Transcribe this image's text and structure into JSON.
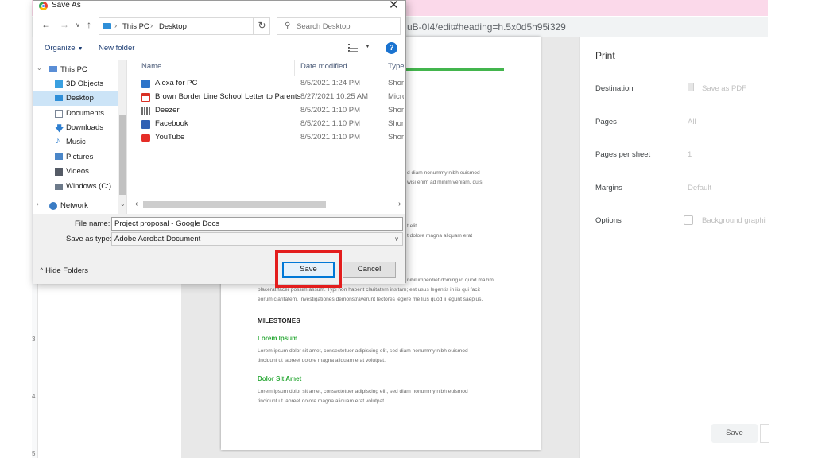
{
  "browser": {
    "url_fragment": "uB-0I4/edit#heading=h.5x0d5h95i329"
  },
  "ruler": {
    "marks": [
      "3",
      "4",
      "5"
    ]
  },
  "document_page": {
    "fragments": [
      "d diam nonummy nibh euismod",
      "wisi enim ad minim veniam, quis",
      "t elit",
      "t dolore magna aliquam erat",
      "nihil imperdiet doming id quod mazim"
    ],
    "para_lines": [
      "placerat facer possim assum. Typi non habent claritatem insitam; est usus legentis in iis qui facit",
      "eorum claritatem. Investigationes demonstraverunt lectores legere me lius quod ii legunt saepius."
    ],
    "milestones_heading": "MILESTONES",
    "sections": [
      {
        "title": "Lorem Ipsum",
        "lines": [
          "Lorem ipsum dolor sit amet, consectetuer adipiscing elit, sed diam nonummy nibh euismod",
          "tincidunt ut laoreet dolore magna aliquam erat volutpat."
        ]
      },
      {
        "title": "Dolor Sit Amet",
        "lines": [
          "Lorem ipsum dolor sit amet, consectetuer adipiscing elit, sed diam nonummy nibh euismod",
          "tincidunt ut laoreet dolore magna aliquam erat volutpat."
        ]
      }
    ]
  },
  "print_panel": {
    "title": "Print",
    "destination_label": "Destination",
    "destination_value": "Save as PDF",
    "pages_label": "Pages",
    "pages_value": "All",
    "pages_per_sheet_label": "Pages per sheet",
    "pages_per_sheet_value": "1",
    "margins_label": "Margins",
    "margins_value": "Default",
    "options_label": "Options",
    "options_value": "Background graphi",
    "save_label": "Save"
  },
  "dialog": {
    "title": "Save As",
    "close_glyph": "✕",
    "nav": {
      "back": "←",
      "forward": "→",
      "recent": "∨",
      "up": "↑",
      "refresh": "↻",
      "dropdown": "∨"
    },
    "breadcrumb": [
      "This PC",
      "Desktop"
    ],
    "search_placeholder": "Search Desktop",
    "search_glyph": "⚲",
    "toolbar": {
      "organize": "Organize",
      "new_folder": "New folder",
      "help": "?"
    },
    "nav_items": [
      {
        "label": "This PC",
        "icon": "computer-icon",
        "color": "#5a8ed6"
      },
      {
        "label": "3D Objects",
        "icon": "cube-icon",
        "color": "#3aa0e0"
      },
      {
        "label": "Desktop",
        "icon": "desktop-folder-icon",
        "color": "#2f8fd8"
      },
      {
        "label": "Documents",
        "icon": "documents-icon",
        "color": "#7a8696"
      },
      {
        "label": "Downloads",
        "icon": "download-icon",
        "color": "#2f7fd0"
      },
      {
        "label": "Music",
        "icon": "music-icon",
        "color": "#2f7fd0"
      },
      {
        "label": "Pictures",
        "icon": "pictures-icon",
        "color": "#4a86c8"
      },
      {
        "label": "Videos",
        "icon": "videos-icon",
        "color": "#555b66"
      },
      {
        "label": "Windows (C:)",
        "icon": "drive-icon",
        "color": "#6d7a8a"
      },
      {
        "label": "Network",
        "icon": "network-icon",
        "color": "#3a7cc4"
      }
    ],
    "columns": {
      "name": "Name",
      "date": "Date modified",
      "type": "Type"
    },
    "files": [
      {
        "name": "Alexa for PC",
        "date": "8/5/2021 1:24 PM",
        "type": "Short",
        "icon": "alexa-shortcut-icon",
        "color": "#2d74c9"
      },
      {
        "name": "Brown Border Line School Letter to Parents",
        "date": "8/27/2021 10:25 AM",
        "type": "Micro",
        "icon": "pdf-file-icon",
        "color": "#d93025"
      },
      {
        "name": "Deezer",
        "date": "8/5/2021 1:10 PM",
        "type": "Short",
        "icon": "deezer-shortcut-icon",
        "color": "#6d6d6d"
      },
      {
        "name": "Facebook",
        "date": "8/5/2021 1:10 PM",
        "type": "Short",
        "icon": "facebook-shortcut-icon",
        "color": "#2f5fb3"
      },
      {
        "name": "YouTube",
        "date": "8/5/2021 1:10 PM",
        "type": "Short",
        "icon": "youtube-shortcut-icon",
        "color": "#e52d27"
      }
    ],
    "filename_label": "File name:",
    "filename_value": "Project proposal - Google Docs",
    "savetype_label": "Save as type:",
    "savetype_value": "Adobe Acrobat Document",
    "hide_folders": "Hide Folders",
    "save_button": "Save",
    "cancel_button": "Cancel"
  },
  "colors": {
    "highlight": "#e31d1d",
    "selection": "#cce4f7",
    "accent": "#0078d7",
    "doc_green": "#43b54d"
  }
}
